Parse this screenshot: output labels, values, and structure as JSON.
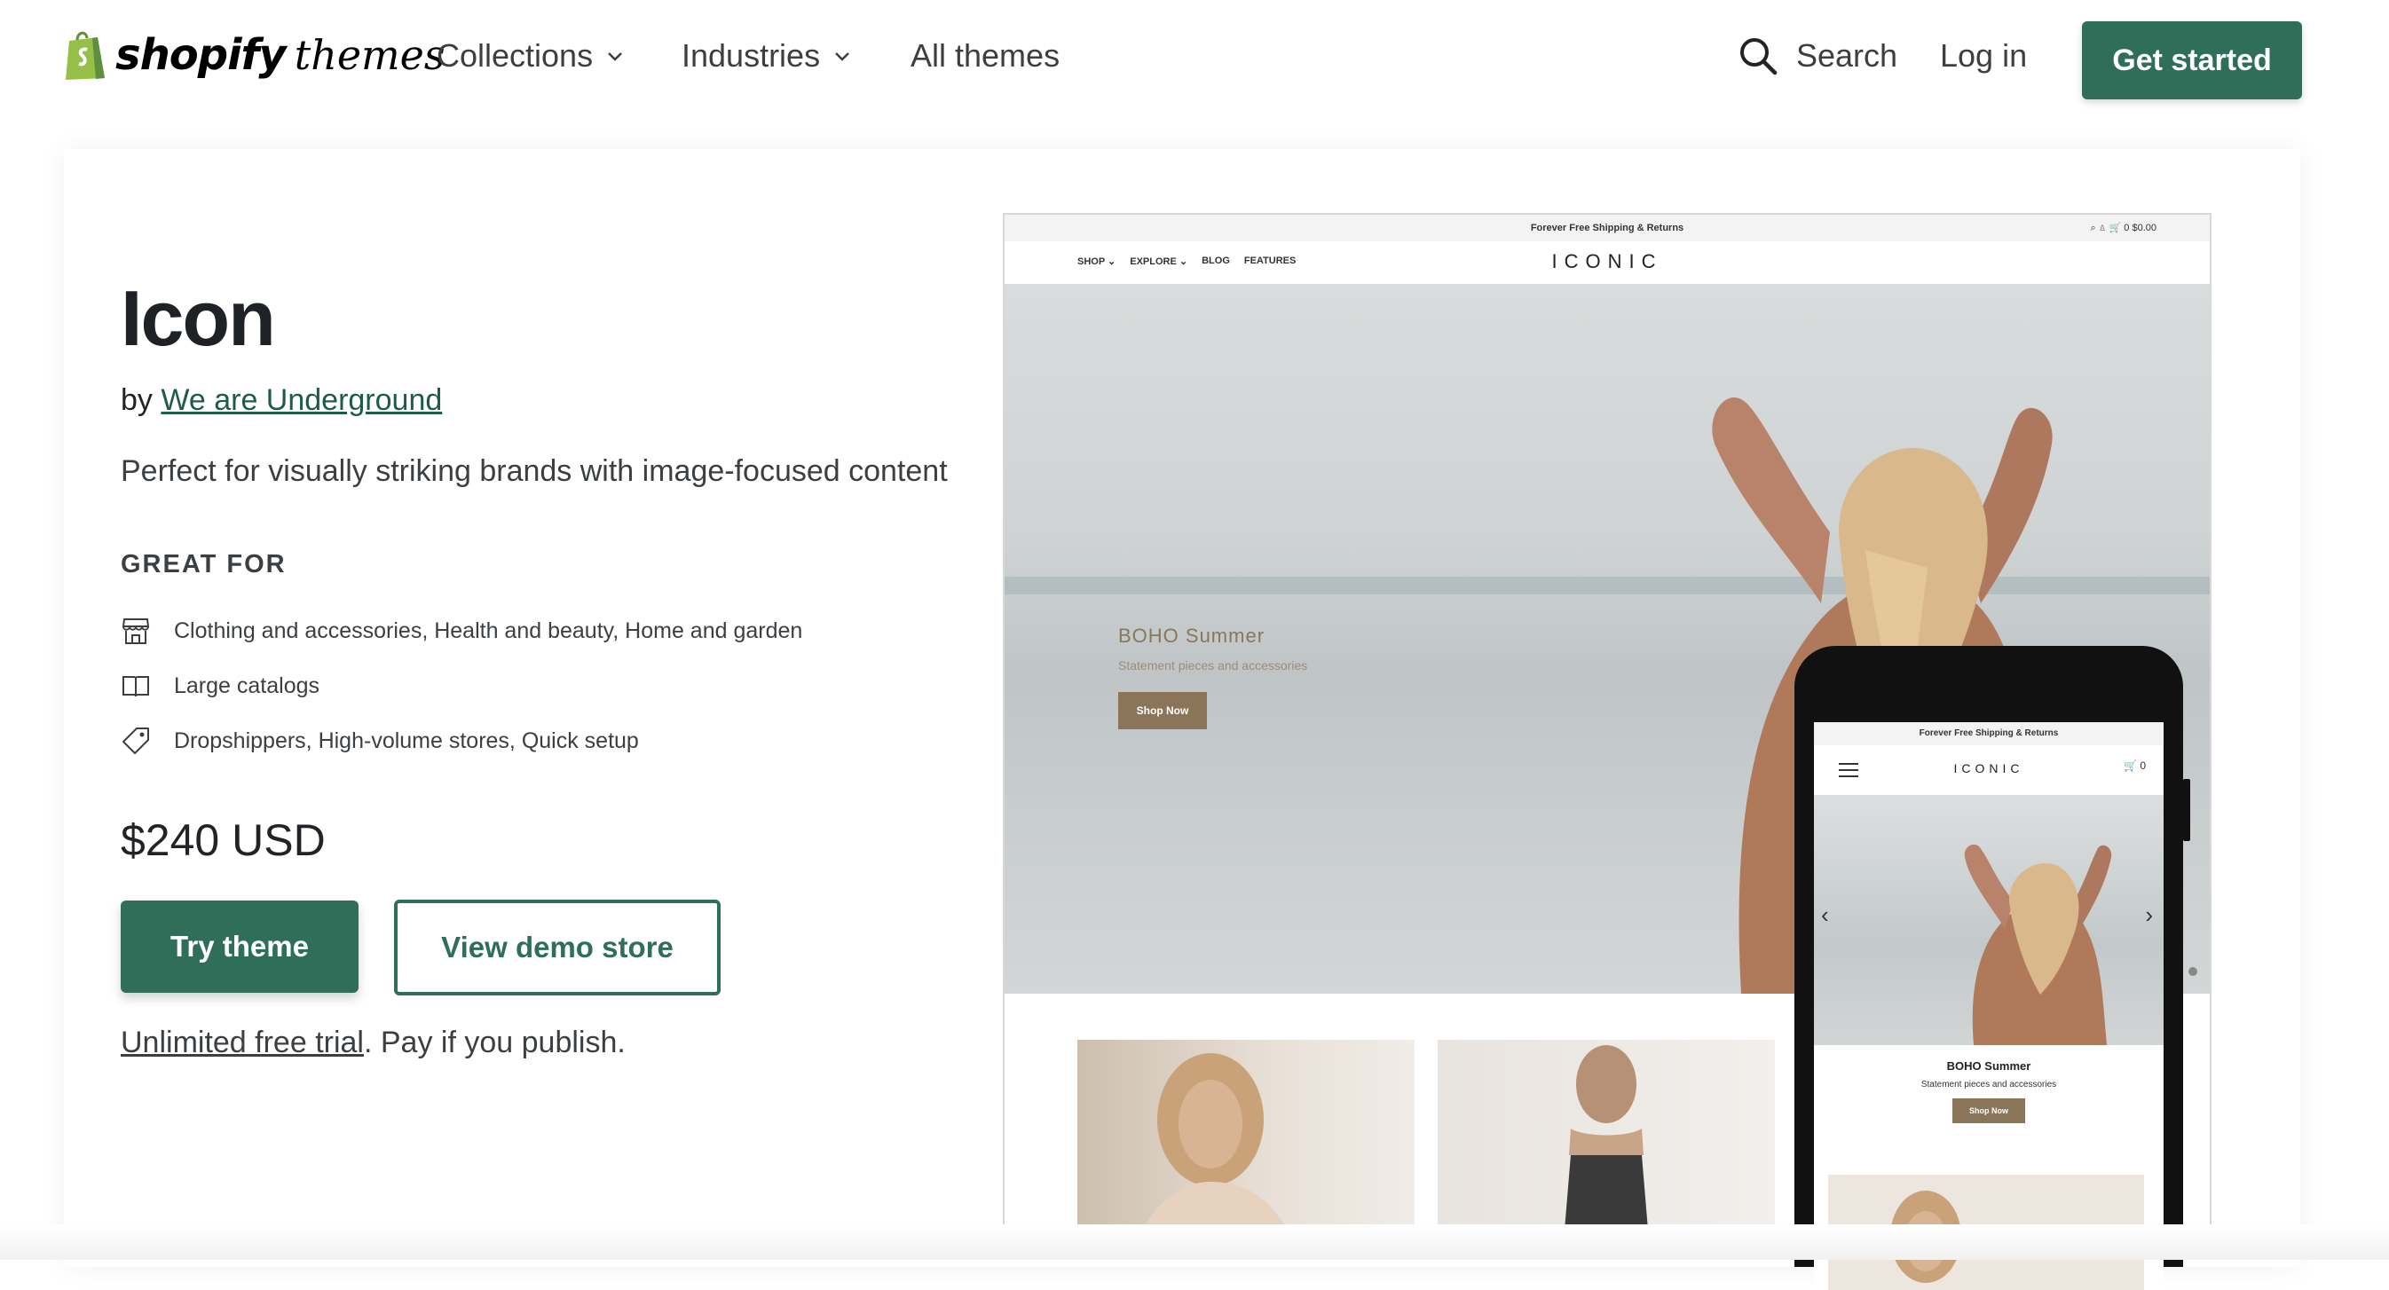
{
  "nav": {
    "logo_word": "shopify",
    "logo_suffix": "themes",
    "collections": "Collections",
    "industries": "Industries",
    "all_themes": "All themes",
    "search": "Search",
    "login": "Log in",
    "get_started": "Get started"
  },
  "theme": {
    "title": "Icon",
    "by": "by",
    "author": "We are Underground",
    "description": "Perfect for visually striking brands with image-focused content",
    "great_for_heading": "GREAT FOR",
    "great_for": [
      {
        "icon": "store-icon",
        "text": "Clothing and accessories, Health and beauty, Home and garden"
      },
      {
        "icon": "book-icon",
        "text": "Large catalogs"
      },
      {
        "icon": "tag-icon",
        "text": "Dropshippers, High-volume stores, Quick setup"
      }
    ],
    "price": "$240 USD",
    "try_button": "Try theme",
    "demo_button": "View demo store",
    "trial_link": "Unlimited free trial",
    "trial_rest": ". Pay if you publish."
  },
  "preview": {
    "announcement": "Forever Free Shipping & Returns",
    "top_icons": "⌕   ♙   🛒 0   $0.00",
    "menu": [
      "SHOP ⌄",
      "EXPLORE ⌄",
      "BLOG",
      "FEATURES"
    ],
    "brand": "ICONIC",
    "hero_heading": "BOHO Summer",
    "hero_sub": "Statement pieces and accessories",
    "hero_button": "Shop Now",
    "phone_announcement": "Forever Free Shipping & Returns",
    "phone_brand": "ICONIC",
    "phone_cart": "🛒 0",
    "phone_heading": "BOHO Summer",
    "phone_sub": "Statement pieces and accessories",
    "phone_button": "Shop Now"
  },
  "colors": {
    "brand_green": "#2f6e59",
    "accent_brown": "#8b7559"
  }
}
